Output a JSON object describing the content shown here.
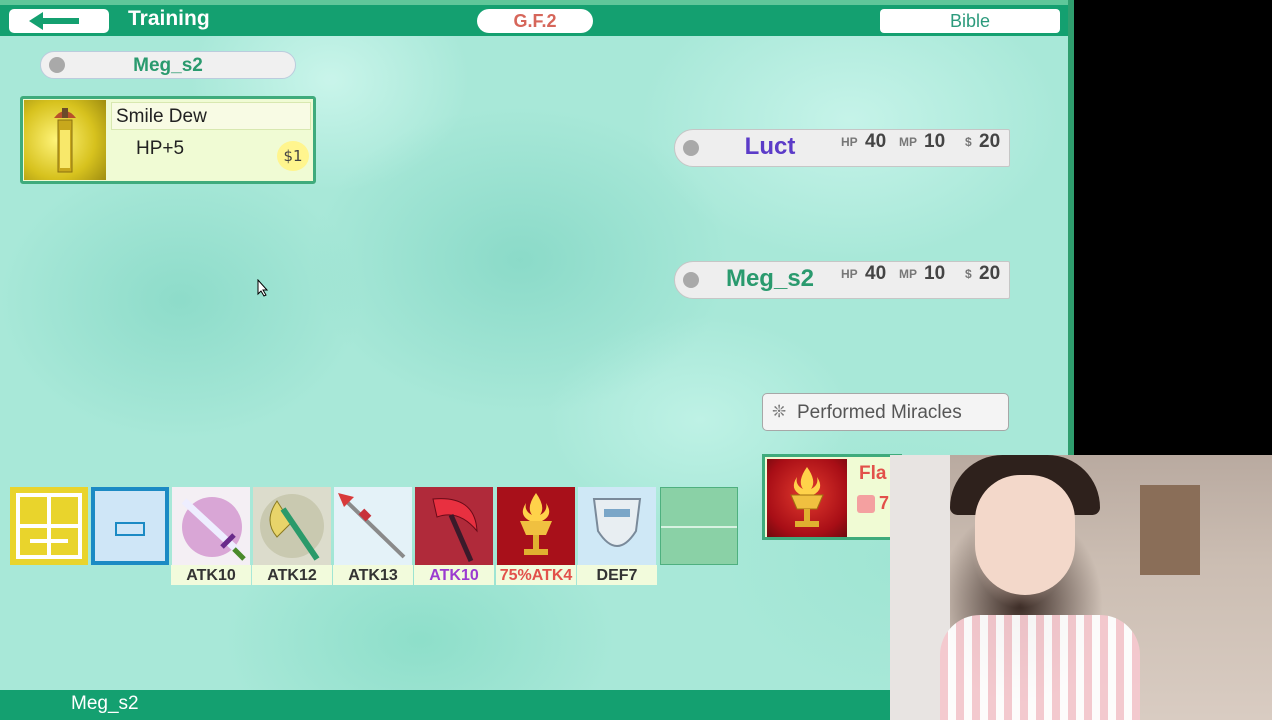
{
  "header": {
    "title": "Training",
    "gf_label": "G.F.2",
    "bible_label": "Bible"
  },
  "player": {
    "name": "Meg_s2"
  },
  "item": {
    "name": "Smile Dew",
    "effect": "HP+5",
    "price": "$1"
  },
  "opponents": [
    {
      "name": "Luct",
      "hp_label": "HP",
      "hp": "40",
      "mp_label": "MP",
      "mp": "10",
      "money_label": "$",
      "money": "20",
      "name_color": "#5b3bc8"
    },
    {
      "name": "Meg_s2",
      "hp_label": "HP",
      "hp": "40",
      "mp_label": "MP",
      "mp": "10",
      "money_label": "$",
      "money": "20",
      "name_color": "#2a9a6e"
    }
  ],
  "miracles": {
    "button_label": "Performed Miracles",
    "card_name": "Fla",
    "card_value": "7"
  },
  "inventory": [
    {
      "label": "ATK10",
      "label_color": "#333333",
      "icon": "sword-icon"
    },
    {
      "label": "ATK12",
      "label_color": "#333333",
      "icon": "axe-icon"
    },
    {
      "label": "ATK13",
      "label_color": "#333333",
      "icon": "spear-icon"
    },
    {
      "label": "ATK10",
      "label_color": "#9b3bd0",
      "icon": "scythe-icon"
    },
    {
      "label": "75%ATK4",
      "label_color": "#e2514a",
      "icon": "chalice-icon"
    },
    {
      "label": "DEF7",
      "label_color": "#333333",
      "icon": "armor-icon"
    }
  ],
  "footer": {
    "name": "Meg_s2"
  },
  "colors": {
    "header_bg": "#14a070",
    "card_border": "#3fab7c",
    "accent_red": "#e2514a"
  }
}
